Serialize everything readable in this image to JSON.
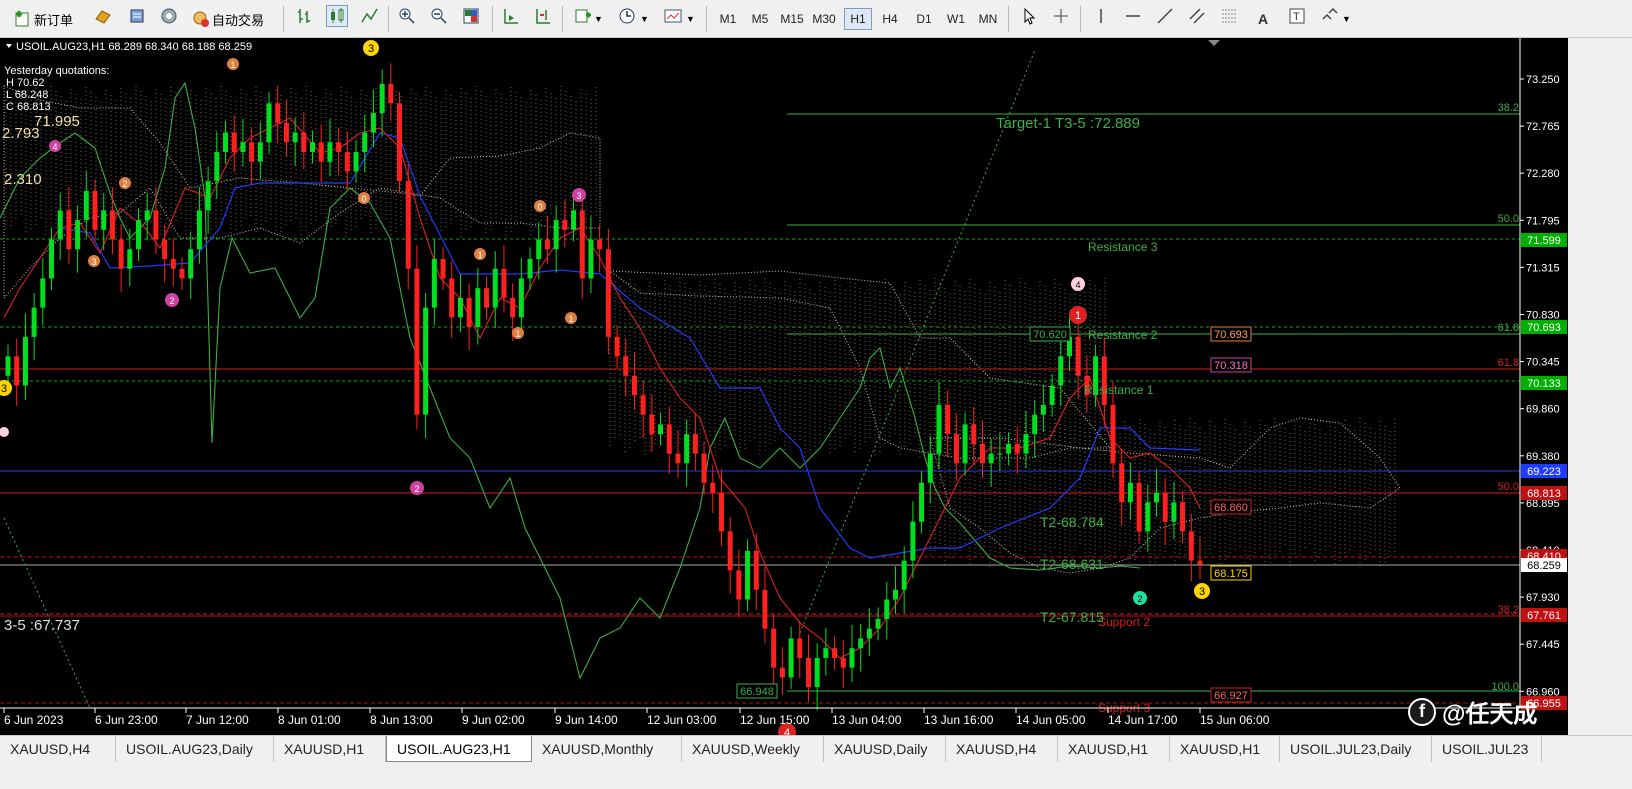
{
  "toolbar": {
    "new_order": "新订单",
    "auto_trade": "自动交易",
    "timeframes": [
      "M1",
      "M5",
      "M15",
      "M30",
      "H1",
      "H4",
      "D1",
      "W1",
      "MN"
    ],
    "active_timeframe": "H1"
  },
  "chart": {
    "header": "USOIL.AUG23,H1   68.289 68.340 68.188 68.259",
    "quotes": {
      "title": "Yesterday quotations:",
      "high": "H 70.62",
      "low": "L 68.248",
      "close": "C 68.813"
    },
    "left_labels": [
      "2.793",
      "71.995",
      "2.310",
      "3-5 :67.737"
    ],
    "price_ticks": [
      "73.250",
      "72.765",
      "72.280",
      "71.795",
      "71.315",
      "70.830",
      "70.345",
      "69.860",
      "69.380",
      "68.895",
      "68.410",
      "67.930",
      "67.445",
      "66.960"
    ],
    "price_flags": [
      {
        "text": "71.599",
        "color": "#00b000"
      },
      {
        "text": "70.693",
        "color": "#00b000"
      },
      {
        "text": "70.133",
        "color": "#00b000"
      },
      {
        "text": "69.223",
        "color": "#1e3cff"
      },
      {
        "text": "68.813",
        "color": "#c01010"
      },
      {
        "text": "68.410",
        "color": "#c01010"
      },
      {
        "text": "68.259",
        "color": "#ffffff"
      },
      {
        "text": "67.761",
        "color": "#c01010"
      },
      {
        "text": "66.955",
        "color": "#c01010"
      }
    ],
    "fib_labels": [
      "38.2",
      "50.0",
      "61.8",
      "61.8",
      "50.0",
      "38.2",
      "100.0"
    ],
    "annotations": {
      "target": "Target-1 T3-5 :72.889",
      "res3": "Resistance 3",
      "res2": "Resistance 2",
      "res1": "Resistance 1",
      "sup2": "Support 2",
      "sup3": "Support 3",
      "t2a": "T2-68.784",
      "t2b": "T2-68.631",
      "t2c": "T2-67.815",
      "box_high": "70.620",
      "box_low": "66.948",
      "box_r1": "70.693",
      "box_r2": "70.318",
      "box_r3": "68.860",
      "box_last": "68.175",
      "box_s": "66.927"
    },
    "time_labels": [
      "6 Jun 2023",
      "6 Jun 23:00",
      "7 Jun 12:00",
      "8 Jun 01:00",
      "8 Jun 13:00",
      "9 Jun 02:00",
      "9 Jun 14:00",
      "12 Jun 03:00",
      "12 Jun 15:00",
      "13 Jun 04:00",
      "13 Jun 16:00",
      "14 Jun 05:00",
      "14 Jun 17:00",
      "15 Jun 06:00"
    ]
  },
  "tabs": [
    "XAUUSD,H4",
    "USOIL.AUG23,Daily",
    "XAUUSD,H1",
    "USOIL.AUG23,H1",
    "XAUUSD,Monthly",
    "XAUUSD,Weekly",
    "XAUUSD,Daily",
    "XAUUSD,H4",
    "XAUUSD,H1",
    "XAUUSD,H1",
    "USOIL.JUL23,Daily",
    "USOIL.JUL23"
  ],
  "active_tab": "USOIL.AUG23,H1",
  "watermark": "@任天成"
}
